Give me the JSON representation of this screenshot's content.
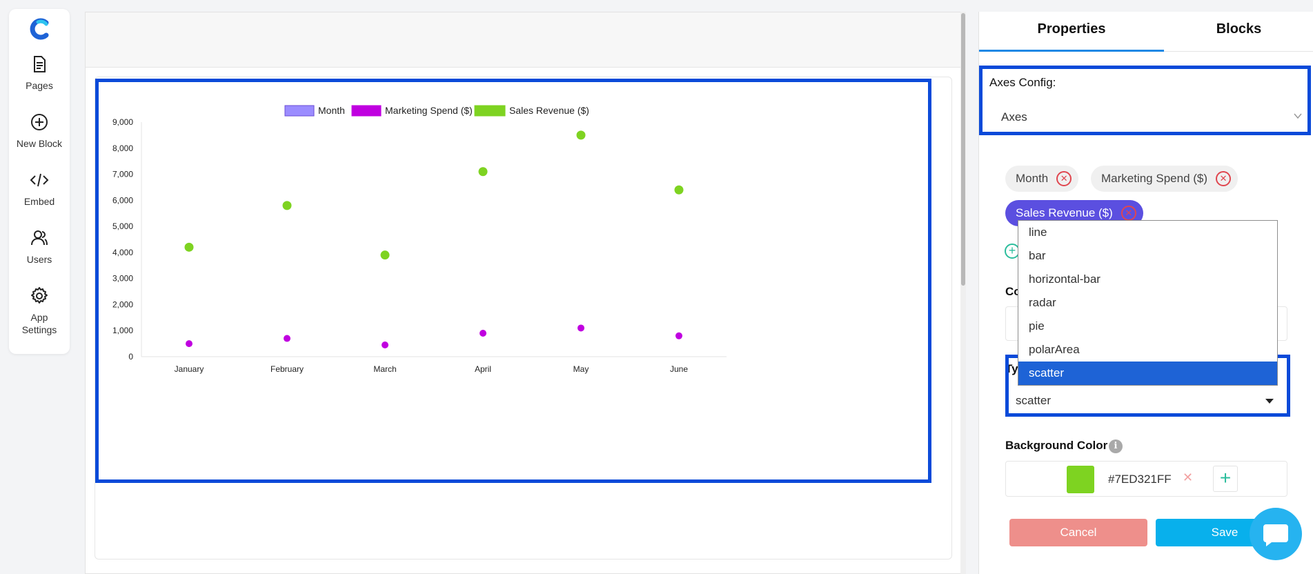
{
  "nav": {
    "items": [
      {
        "label": "Pages",
        "icon": "pages-icon"
      },
      {
        "label": "New Block",
        "icon": "plus-circle-icon"
      },
      {
        "label": "Embed",
        "icon": "code-icon"
      },
      {
        "label": "Users",
        "icon": "users-icon"
      },
      {
        "label": "App Settings",
        "icon": "gear-icon"
      }
    ]
  },
  "panel": {
    "tabs": [
      "Properties",
      "Blocks"
    ],
    "axes_config_label": "Axes Config:",
    "axes_value": "Axes",
    "chips": [
      "Month",
      "Marketing Spend ($)",
      "Sales Revenue ($)"
    ],
    "co_label": "Co",
    "ty_label": "Ty",
    "type_options": [
      "line",
      "bar",
      "horizontal-bar",
      "radar",
      "pie",
      "polarArea",
      "scatter"
    ],
    "type_selected": "scatter",
    "bg_label": "Background Color",
    "bg_color": "#7ED321FF",
    "cancel_label": "Cancel",
    "save_label": "Save"
  },
  "colors": {
    "accent_blue": "#0a4ad9",
    "month": "#9b8cff",
    "marketing": "#c000e0",
    "sales": "#7ed321"
  },
  "chart_data": {
    "type": "scatter",
    "categories": [
      "January",
      "February",
      "March",
      "April",
      "May",
      "June"
    ],
    "series": [
      {
        "name": "Month",
        "values": [],
        "color": "#9b8cff"
      },
      {
        "name": "Marketing Spend ($)",
        "values": [
          500,
          700,
          450,
          900,
          1100,
          800
        ],
        "color": "#c000e0"
      },
      {
        "name": "Sales Revenue ($)",
        "values": [
          4200,
          5800,
          3900,
          7100,
          8500,
          6400
        ],
        "color": "#7ed321"
      }
    ],
    "ylim": [
      0,
      9000
    ],
    "yticks": [
      0,
      1000,
      2000,
      3000,
      4000,
      5000,
      6000,
      7000,
      8000,
      9000
    ],
    "legend": "top",
    "grid": false
  }
}
